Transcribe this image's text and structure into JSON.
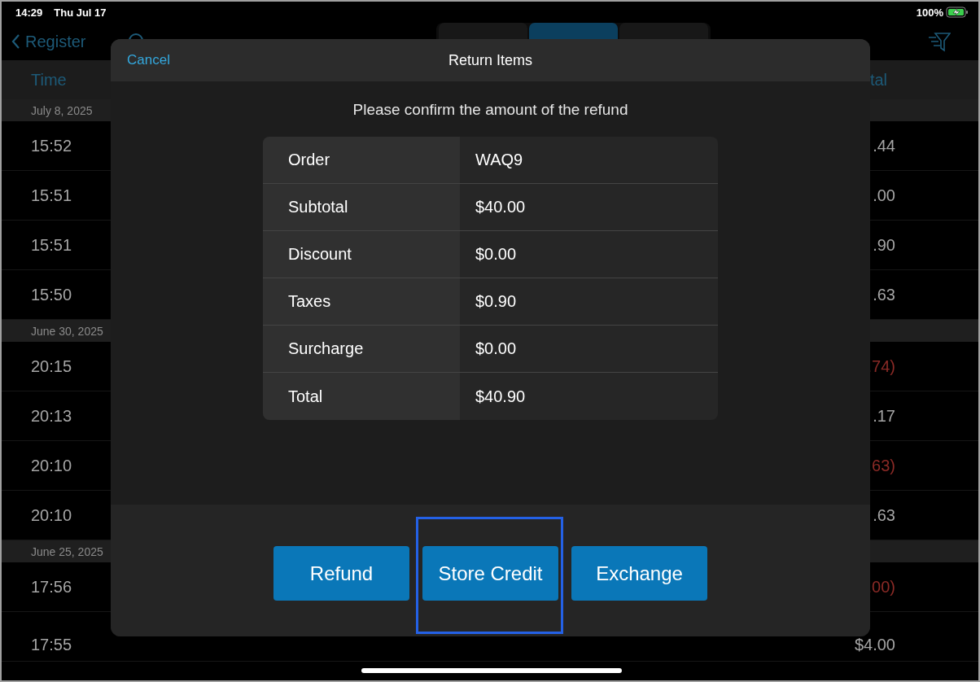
{
  "status_bar": {
    "time": "14:29",
    "date": "Thu Jul 17",
    "battery": "100%"
  },
  "nav": {
    "back": "Register",
    "segments": [
      {
        "selected": false
      },
      {
        "selected": true
      },
      {
        "selected": false
      }
    ]
  },
  "list": {
    "columns": [
      "Time",
      "tal"
    ],
    "sections": [
      {
        "date": "July 8, 2025",
        "rows": [
          {
            "time": "15:52",
            "total": ".44",
            "negative": false
          },
          {
            "time": "15:51",
            "total": ".00",
            "negative": false
          },
          {
            "time": "15:51",
            "total": ".90",
            "negative": false
          },
          {
            "time": "15:50",
            "total": ".63",
            "negative": false
          }
        ]
      },
      {
        "date": "June 30, 2025",
        "rows": [
          {
            "time": "20:15",
            "total": ".74)",
            "negative": true
          },
          {
            "time": "20:13",
            "total": ".17",
            "negative": false
          },
          {
            "time": "20:10",
            "total": ".63)",
            "negative": true
          },
          {
            "time": "20:10",
            "total": ".63",
            "negative": false
          }
        ]
      },
      {
        "date": "June 25, 2025",
        "rows": [
          {
            "time": "17:56",
            "total": ".00)",
            "negative": true
          },
          {
            "time": "17:55",
            "total": "$4.00",
            "negative": false
          }
        ]
      }
    ]
  },
  "modal": {
    "cancel": "Cancel",
    "title": "Return Items",
    "prompt": "Please confirm the amount of the refund",
    "summary": [
      {
        "label": "Order",
        "value": "WAQ9"
      },
      {
        "label": "Subtotal",
        "value": "$40.00"
      },
      {
        "label": "Discount",
        "value": "$0.00"
      },
      {
        "label": "Taxes",
        "value": "$0.90"
      },
      {
        "label": "Surcharge",
        "value": "$0.00"
      },
      {
        "label": "Total",
        "value": "$40.90"
      }
    ],
    "buttons": [
      {
        "label": "Refund",
        "highlighted": false
      },
      {
        "label": "Store Credit",
        "highlighted": true
      },
      {
        "label": "Exchange",
        "highlighted": false
      }
    ]
  }
}
